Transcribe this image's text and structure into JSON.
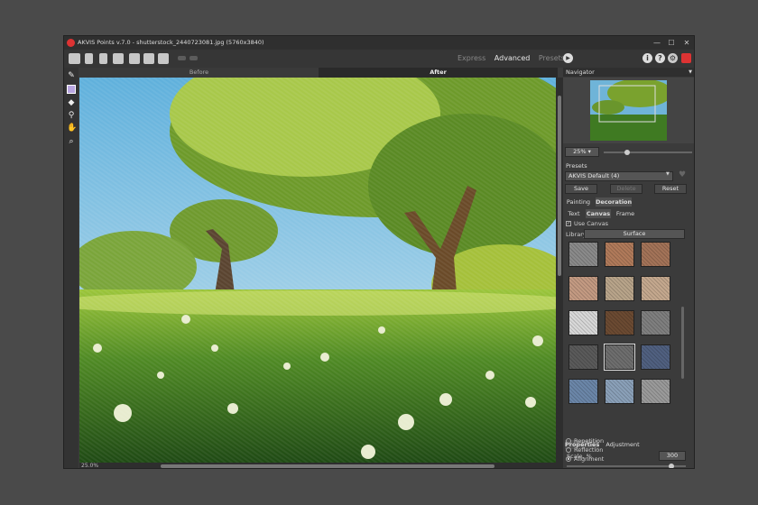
{
  "window": {
    "title": "AKVIS Points v.7.0 - shutterstock_2440723081.jpg (5760x3840)",
    "minimize": "—",
    "maximize": "☐",
    "close": "✕"
  },
  "toolbar": {
    "modes": [
      "Express",
      "Advanced",
      "Presets"
    ],
    "active_mode": "Advanced",
    "run_icon": "play-icon",
    "info_label": "i",
    "help_label": "?",
    "settings_icon": "gear-icon",
    "exit_icon": "exit-icon"
  },
  "view_tabs": {
    "before": "Before",
    "after": "After"
  },
  "zoom": {
    "status": "25.0%",
    "nav_zoom": "25% ▾"
  },
  "navigator": {
    "title": "Navigator"
  },
  "presets": {
    "title": "Presets",
    "selected": "AKVIS Default (4)",
    "save": "Save",
    "delete": "Delete",
    "reset": "Reset"
  },
  "tabs_main": [
    "Painting",
    "Decoration"
  ],
  "tabs_main_active": "Decoration",
  "tabs_sub": [
    "Text",
    "Canvas",
    "Frame"
  ],
  "tabs_sub_active": "Canvas",
  "canvas": {
    "use_canvas_label": "Use Canvas",
    "use_canvas_checked": true,
    "library_label": "Library",
    "library_value": "Surface"
  },
  "texture_colors": [
    "#8a8a8a",
    "#b07a5a",
    "#a37358",
    "#c39a82",
    "#b8a48a",
    "#c4a88e",
    "#d8d8d8",
    "#6b4a32",
    "#7f7f7f",
    "#5a5a5a",
    "#6e6e6e",
    "#506080",
    "#6b86a8",
    "#8aa0b8",
    "#9a9a9a"
  ],
  "selected_texture_index": 10,
  "props_tabs": [
    "Properties",
    "Adjustment"
  ],
  "props_active": "Properties",
  "scale": {
    "label": "Scale, %",
    "value": "300",
    "fraction": 0.9
  },
  "placement": {
    "options": [
      "Repetition",
      "Reflection",
      "Alignment"
    ],
    "selected": "Alignment"
  }
}
